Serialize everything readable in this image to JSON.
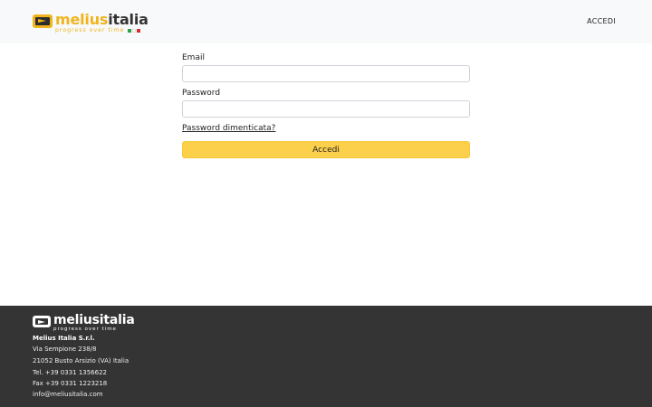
{
  "header": {
    "logo": {
      "word_part1": "melius",
      "word_part2": "italia",
      "tagline": "progress over time",
      "flag_colors": [
        "#2e9e48",
        "#ffffff",
        "#d22f27"
      ]
    },
    "nav_login": "ACCEDI"
  },
  "form": {
    "email_label": "Email",
    "email_value": "",
    "password_label": "Password",
    "password_value": "",
    "forgot_link": "Password dimenticata?",
    "submit_label": "Accedi"
  },
  "footer": {
    "logo": {
      "word_part1": "melius",
      "word_part2": "italia",
      "tagline": "progress over time"
    },
    "company": "Melius Italia S.r.l.",
    "address_line1": "Via Sempione 238/8",
    "address_line2": "21052 Busto Arsizio (VA) Italia",
    "tel": "Tel. +39 0331 1356622",
    "fax": "Fax +39 0331 1223218",
    "email": "info@meliusitalia.com"
  },
  "colors": {
    "accent": "#fcd04b",
    "brand_yellow": "#f0b41c",
    "footer_bg": "#343434",
    "header_bg": "#f8f9fa"
  }
}
